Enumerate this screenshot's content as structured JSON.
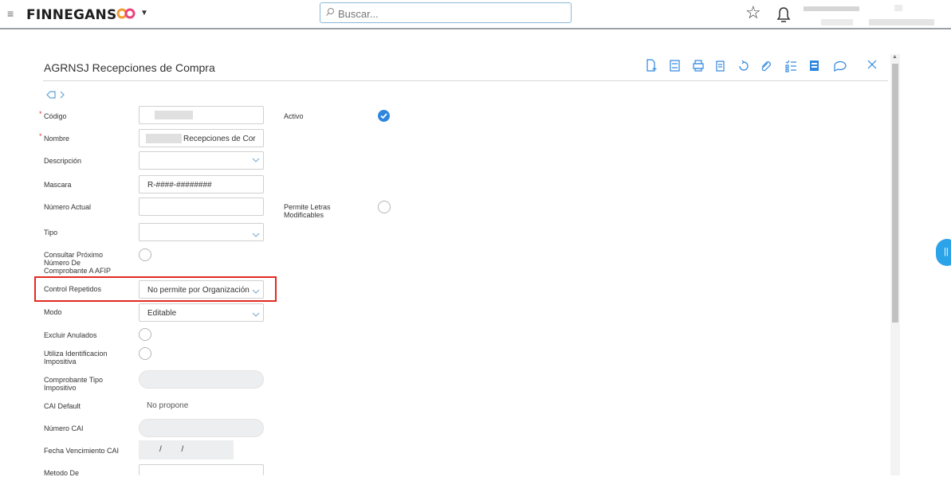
{
  "header": {
    "brand": "FINNEGANS",
    "search_placeholder": "Buscar..."
  },
  "form": {
    "title": "AGRNSJ Recepciones de Compra",
    "fields": {
      "codigo_label": "Código",
      "nombre_label": "Nombre",
      "nombre_value": "Recepciones de Cor",
      "activo_label": "Activo",
      "descripcion_label": "Descripción",
      "mascara_label": "Mascara",
      "mascara_value": "R-####-########",
      "numero_actual_label": "Número Actual",
      "permite_letras_label_1": "Permite Letras",
      "permite_letras_label_2": "Modificables",
      "tipo_label": "Tipo",
      "consultar_label_1": "Consultar Próximo",
      "consultar_label_2": "Número De",
      "consultar_label_3": "Comprobante A AFIP",
      "control_repetidos_label": "Control Repetidos",
      "control_repetidos_value": "No permite por Organización",
      "modo_label": "Modo",
      "modo_value": "Editable",
      "excluir_anulados_label": "Excluir Anulados",
      "utiliza_ident_label_1": "Utiliza Identificacion",
      "utiliza_ident_label_2": "Impositiva",
      "comprobante_tipo_label_1": "Comprobante Tipo",
      "comprobante_tipo_label_2": "Impositivo",
      "cai_default_label": "CAI Default",
      "cai_default_value": "No propone",
      "numero_cai_label": "Número CAI",
      "fecha_venc_label": "Fecha Vencimiento CAI",
      "fecha_venc_value": "/ /",
      "metodo_label": "Metodo De"
    }
  },
  "colors": {
    "accent": "#2e86de",
    "highlight": "#e22b1f",
    "required": "#e53935"
  }
}
